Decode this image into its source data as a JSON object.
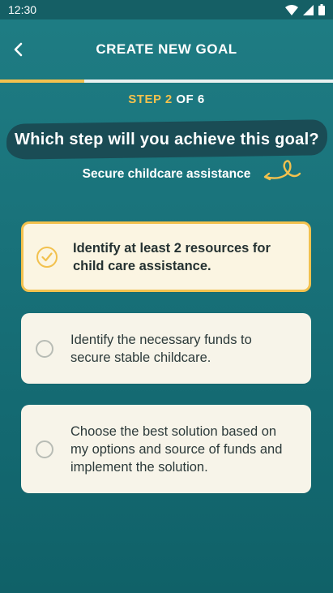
{
  "status_bar": {
    "time": "12:30"
  },
  "header": {
    "title": "CREATE NEW GOAL"
  },
  "progress": {
    "current_step": 2,
    "total_steps": 6,
    "fraction": 0.25
  },
  "step": {
    "prefix": "STEP ",
    "current": "2",
    "of_text": " OF 6"
  },
  "question": {
    "text": "Which step will you achieve this goal?"
  },
  "goal": {
    "name": "Secure childcare assistance"
  },
  "options": [
    {
      "label": "Identify at least 2 resources for child care assistance.",
      "selected": true
    },
    {
      "label": "Identify the necessary funds to secure stable childcare.",
      "selected": false
    },
    {
      "label": "Choose the best solution based on my options and source of funds and implement the solution.",
      "selected": false
    }
  ],
  "colors": {
    "accent": "#f2c14e",
    "background": "#19727a",
    "card": "#f7f4e9",
    "question_bg": "#1a4c55"
  }
}
